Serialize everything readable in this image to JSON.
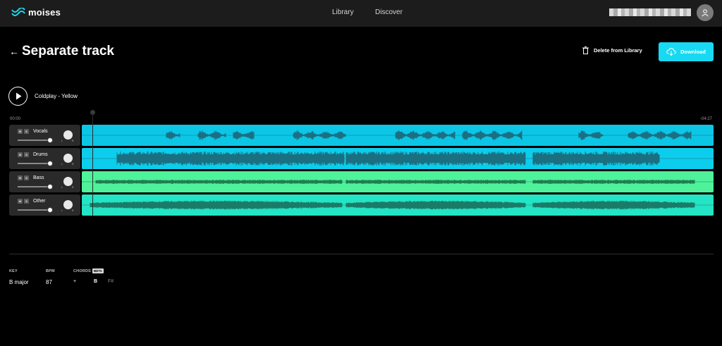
{
  "app": {
    "name": "moises"
  },
  "nav": {
    "items": [
      {
        "label": "Library"
      },
      {
        "label": "Discover"
      }
    ]
  },
  "header": {
    "title": "Separate track",
    "delete_label": "Delete from Library",
    "download_label": "Download"
  },
  "player": {
    "song_title": "Coldplay - Yellow",
    "time_start": "00:00",
    "time_end": "-04:27"
  },
  "tracks": [
    {
      "name": "Vocals",
      "mute_label": "M",
      "solo_label": "S",
      "pan_left": "L",
      "pan_right": "R",
      "color": "#0cc6e6",
      "wave_color": "#1b6f82"
    },
    {
      "name": "Drums",
      "mute_label": "M",
      "solo_label": "S",
      "pan_left": "L",
      "pan_right": "R",
      "color": "#0ccdec",
      "wave_color": "#1a6f80"
    },
    {
      "name": "Bass",
      "mute_label": "M",
      "solo_label": "S",
      "pan_left": "L",
      "pan_right": "R",
      "color": "#4ef29a",
      "wave_color": "#1f7f52"
    },
    {
      "name": "Other",
      "mute_label": "M",
      "solo_label": "S",
      "pan_left": "L",
      "pan_right": "R",
      "color": "#23e4c4",
      "wave_color": "#1a7b68"
    }
  ],
  "song_info": {
    "key_label": "KEY",
    "key_value": "B major",
    "bpm_label": "BPM",
    "bpm_value": "87",
    "chords_label": "CHORDS",
    "beta_label": "BETA",
    "chords": [
      "+",
      "B",
      "F#"
    ]
  },
  "colors": {
    "accent": "#18d9f1",
    "nav_bg": "#1c1c1c",
    "panel_bg": "#2a2a2a"
  },
  "icons": {
    "logo": "moises-wave-logo",
    "back": "arrow-left-icon",
    "delete": "trash-icon",
    "download": "cloud-download-icon",
    "play": "play-icon",
    "user": "user-icon"
  }
}
